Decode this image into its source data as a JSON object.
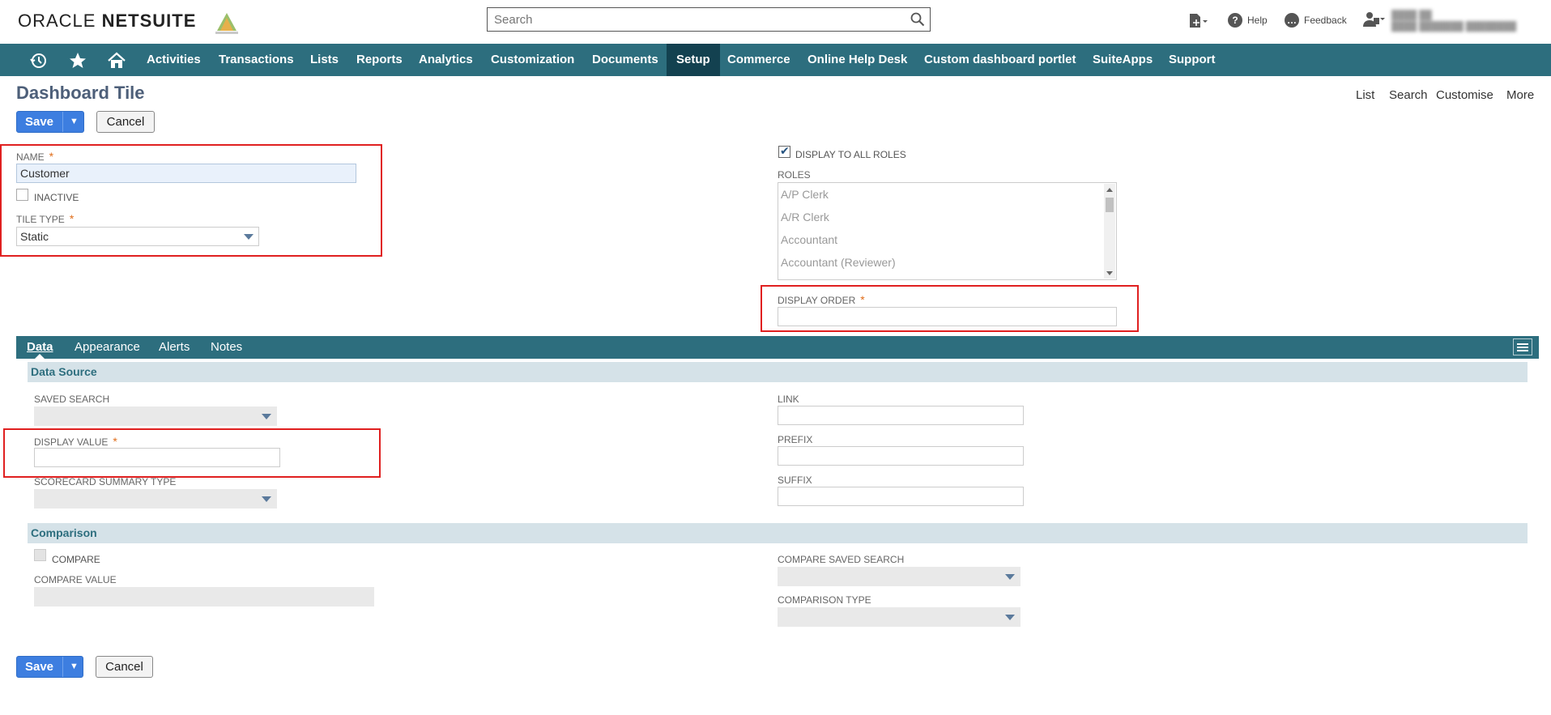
{
  "header": {
    "logo_main": "ORACLE",
    "logo_brand": "NETSUITE",
    "search_placeholder": "Search",
    "help_label": "Help",
    "feedback_label": "Feedback"
  },
  "nav": {
    "items": [
      "Activities",
      "Transactions",
      "Lists",
      "Reports",
      "Analytics",
      "Customization",
      "Documents",
      "Setup",
      "Commerce",
      "Online Help Desk",
      "Custom dashboard portlet",
      "SuiteApps",
      "Support"
    ],
    "active": "Setup"
  },
  "page": {
    "title": "Dashboard Tile",
    "links": [
      "List",
      "Search",
      "Customise",
      "More"
    ],
    "save_label": "Save",
    "cancel_label": "Cancel"
  },
  "form": {
    "name_label": "NAME",
    "name_value": "Customer",
    "inactive_label": "INACTIVE",
    "tile_type_label": "TILE TYPE",
    "tile_type_value": "Static",
    "display_all_roles_label": "DISPLAY TO ALL ROLES",
    "display_all_roles_checked": true,
    "roles_label": "ROLES",
    "roles": [
      "A/P Clerk",
      "A/R Clerk",
      "Accountant",
      "Accountant (Reviewer)"
    ],
    "display_order_label": "DISPLAY ORDER",
    "display_order_value": ""
  },
  "tabs": [
    "Data",
    "Appearance",
    "Alerts",
    "Notes"
  ],
  "data_tab": {
    "data_source_title": "Data Source",
    "saved_search_label": "SAVED SEARCH",
    "display_value_label": "DISPLAY VALUE",
    "scorecard_label": "SCORECARD SUMMARY TYPE",
    "link_label": "LINK",
    "prefix_label": "PREFIX",
    "suffix_label": "SUFFIX",
    "comparison_title": "Comparison",
    "compare_label": "COMPARE",
    "compare_value_label": "COMPARE VALUE",
    "compare_saved_search_label": "COMPARE SAVED SEARCH",
    "comparison_type_label": "COMPARISON TYPE"
  },
  "colors": {
    "nav_bg": "#2d6e7e",
    "nav_active": "#134150",
    "save_blue": "#3d7ee0",
    "highlight_red": "#e02020",
    "required": "#e06d1a"
  }
}
